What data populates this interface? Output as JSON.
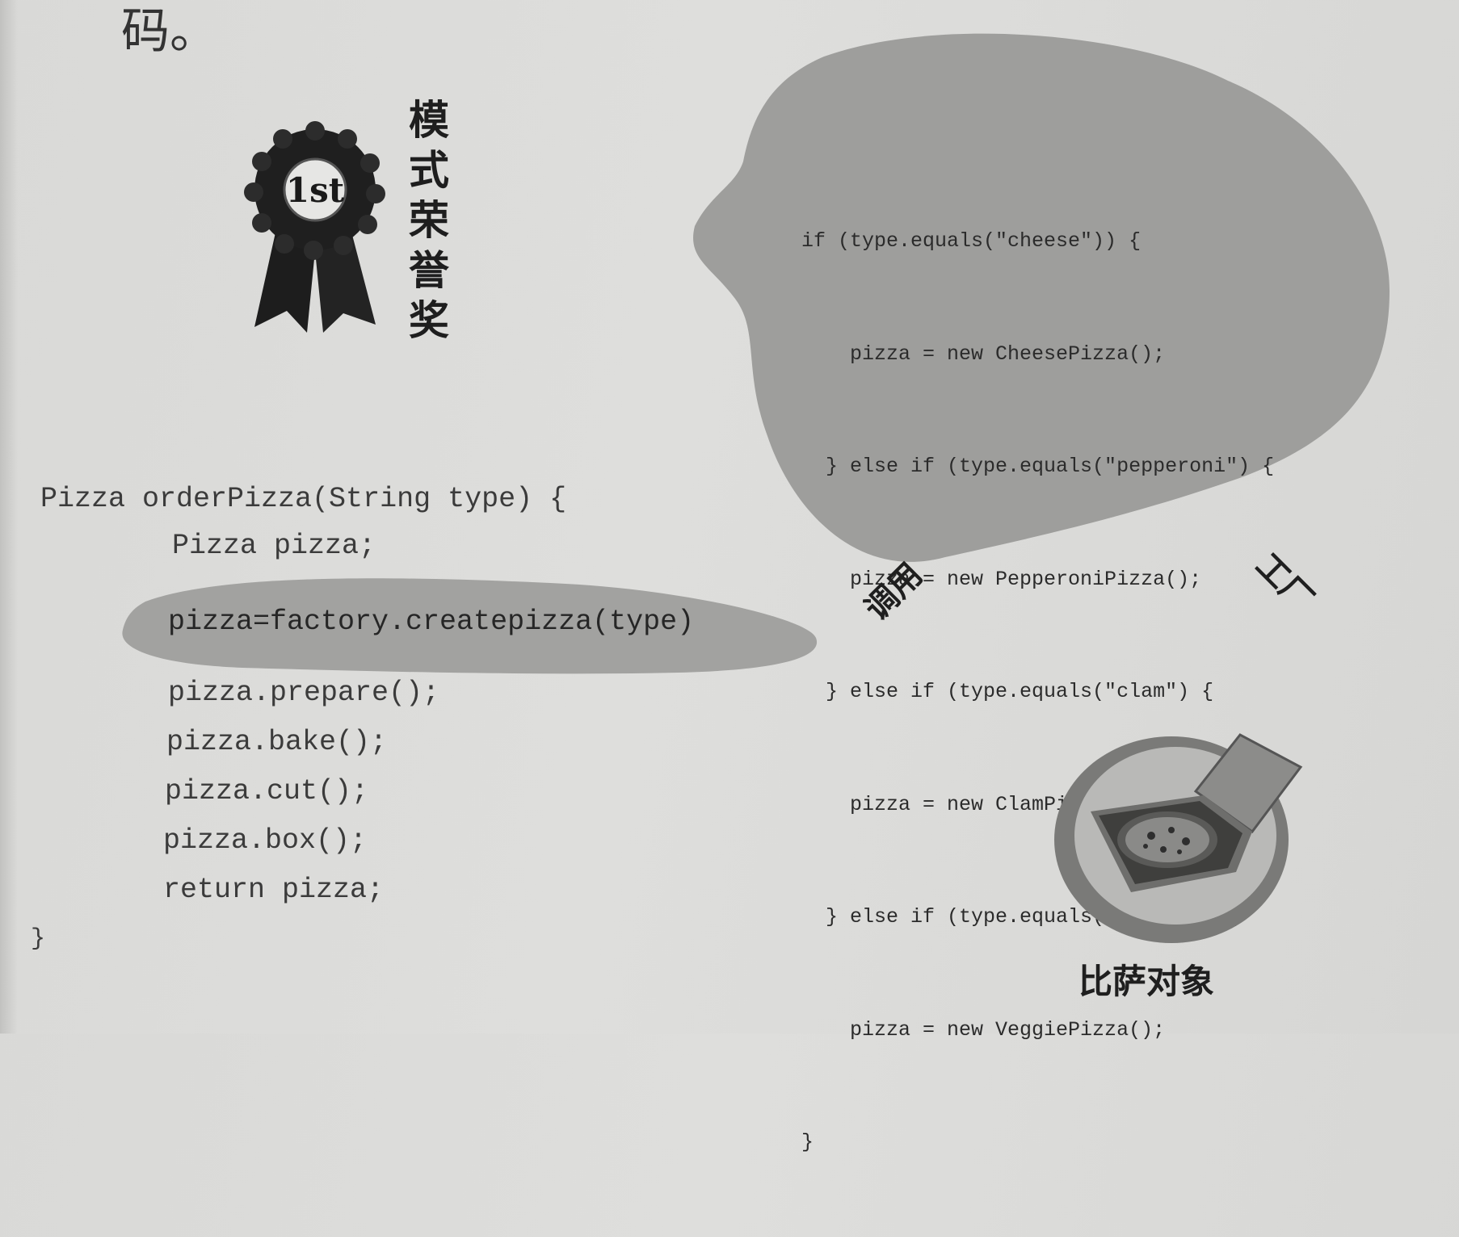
{
  "top_text": "码。",
  "award": {
    "title": "模式荣誉奖",
    "ribbon_icon": "first-place-ribbon-icon"
  },
  "factory_code": [
    "if (type.equals(\"cheese\")) {",
    "    pizza = new CheesePizza();",
    "  } else if (type.equals(\"pepperoni\") {",
    "    pizza = new PepperoniPizza();",
    "  } else if (type.equals(\"clam\") {",
    "    pizza = new ClamPizza();",
    "  } else if (type.equals(\"veggie\") {",
    "    pizza = new VeggiePizza();",
    "}"
  ],
  "client_code": {
    "signature": "Pizza orderPizza(String type) {",
    "declaration": "Pizza pizza;",
    "factory_call": "pizza=factory.createpizza(type)",
    "calls": [
      "pizza.prepare();",
      "pizza.bake();",
      "pizza.cut();",
      "pizza.box();",
      "return pizza;"
    ],
    "closing": "}"
  },
  "labels": {
    "caller": "调用",
    "factory": "工厂",
    "pizza_object": "比萨对象"
  },
  "colors": {
    "paper": "#dcdcda",
    "blob": "#9d9d9b",
    "highlight": "#a3a3a1",
    "ink": "#2a2a2a"
  }
}
